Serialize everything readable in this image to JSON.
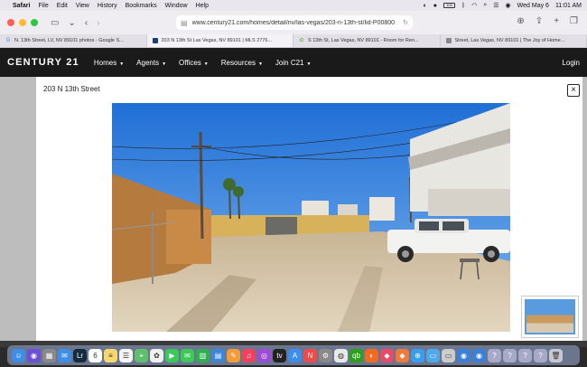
{
  "menubar": {
    "app": "Safari",
    "items": [
      "File",
      "Edit",
      "View",
      "History",
      "Bookmarks",
      "Window",
      "Help"
    ],
    "date": "Wed May 6",
    "time": "11:01 AM",
    "battery": "100"
  },
  "browser": {
    "url": "www.century21.com/homes/detail/nv/las-vegas/203-n-13th-st/lid-P00800",
    "tabs": [
      {
        "label": "N. 13th Street, LV, NV 89101 photos - Google S...",
        "icon": "google-icon",
        "color": "#4285f4"
      },
      {
        "label": "203 N 13th St Las Vegas, NV 89101 | MLS 2776...",
        "icon": "century21-icon",
        "color": "#1b3d7a"
      },
      {
        "label": "S 13th St, Las Vegas, NV 89101 - Room for Ren...",
        "icon": "roomies-icon",
        "color": "#6abf4b"
      },
      {
        "label": "Street, Las Vegas, NV 89101 | The Joy of Home...",
        "icon": "joy-icon",
        "color": "#888888"
      }
    ]
  },
  "site": {
    "logo": "CENTURY 21",
    "nav": [
      "Homes",
      "Agents",
      "Offices",
      "Resources",
      "Join C21"
    ],
    "login": "Login"
  },
  "modal": {
    "title": "203 N 13th Street",
    "close": "×"
  },
  "dock": {
    "icons": [
      {
        "name": "finder-icon",
        "color": "#3b8fe6",
        "glyph": "☺"
      },
      {
        "name": "siri-icon",
        "color": "#6b4fd8",
        "glyph": "◉"
      },
      {
        "name": "launchpad-icon",
        "color": "#8a8a8a",
        "glyph": "▦"
      },
      {
        "name": "mail-icon",
        "color": "#3e8ee8",
        "glyph": "✉"
      },
      {
        "name": "lightroom-icon",
        "color": "#152b3f",
        "glyph": "Lr"
      },
      {
        "name": "calendar-icon",
        "color": "#ffffff",
        "glyph": "6"
      },
      {
        "name": "notes-icon",
        "color": "#f5d76e",
        "glyph": "≡"
      },
      {
        "name": "reminders-icon",
        "color": "#f5f5f5",
        "glyph": "☰"
      },
      {
        "name": "maps-icon",
        "color": "#5fbf6a",
        "glyph": "⌖"
      },
      {
        "name": "photos-icon",
        "color": "#f0f0f0",
        "glyph": "✿"
      },
      {
        "name": "facetime-icon",
        "color": "#3cc95a",
        "glyph": "▶"
      },
      {
        "name": "messages-icon",
        "color": "#3cc95a",
        "glyph": "✉"
      },
      {
        "name": "numbers-icon",
        "color": "#2fae4f",
        "glyph": "▥"
      },
      {
        "name": "keynote-icon",
        "color": "#3a86d8",
        "glyph": "▤"
      },
      {
        "name": "pages-icon",
        "color": "#f29b38",
        "glyph": "✎"
      },
      {
        "name": "music-icon",
        "color": "#f2415e",
        "glyph": "♫"
      },
      {
        "name": "podcasts-icon",
        "color": "#9b4bd8",
        "glyph": "◎"
      },
      {
        "name": "tv-icon",
        "color": "#222222",
        "glyph": "tv"
      },
      {
        "name": "appstore-icon",
        "color": "#3a8ef0",
        "glyph": "A"
      },
      {
        "name": "news-icon",
        "color": "#f04a4a",
        "glyph": "N"
      },
      {
        "name": "settings-icon",
        "color": "#8a8a8a",
        "glyph": "⚙"
      },
      {
        "name": "chrome-icon",
        "color": "#e8e8e8",
        "glyph": "◍"
      },
      {
        "name": "quickbooks-icon",
        "color": "#2ca01c",
        "glyph": "qb"
      },
      {
        "name": "firefox-icon",
        "color": "#f26b21",
        "glyph": "◐"
      },
      {
        "name": "app-icon",
        "color": "#e84a6a",
        "glyph": "◆"
      },
      {
        "name": "app2-icon",
        "color": "#f07a3a",
        "glyph": "◆"
      },
      {
        "name": "safari-icon",
        "color": "#3a9ef0",
        "glyph": "⊕"
      },
      {
        "name": "screen-icon",
        "color": "#4fa8e8",
        "glyph": "▭"
      },
      {
        "name": "app3-icon",
        "color": "#cccccc",
        "glyph": "▭"
      },
      {
        "name": "globe-icon",
        "color": "#3a7fd8",
        "glyph": "◉"
      },
      {
        "name": "globe2-icon",
        "color": "#3a7fd8",
        "glyph": "◉"
      },
      {
        "name": "help-icon",
        "color": "#a8a8c8",
        "glyph": "?"
      },
      {
        "name": "help2-icon",
        "color": "#a8a8c8",
        "glyph": "?"
      },
      {
        "name": "help3-icon",
        "color": "#a8a8c8",
        "glyph": "?"
      },
      {
        "name": "help4-icon",
        "color": "#a8a8c8",
        "glyph": "?"
      },
      {
        "name": "trash-icon",
        "color": "#c8c8d0",
        "glyph": "🗑"
      }
    ]
  }
}
